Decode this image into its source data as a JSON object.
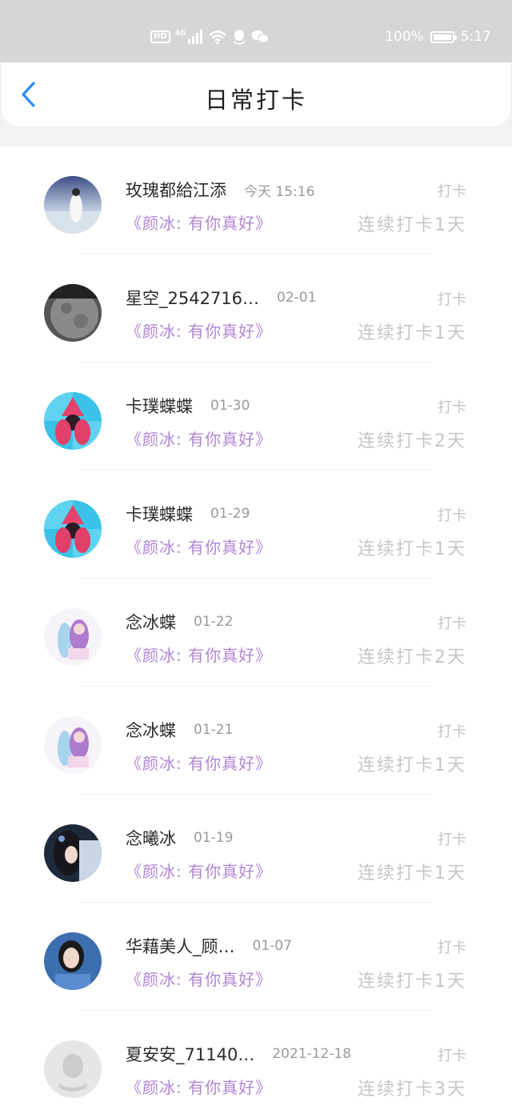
{
  "status_bar": {
    "hd": "HD",
    "network": "4G",
    "battery_percent": "100%",
    "time": "5:17",
    "icons": [
      "hd-icon",
      "signal-icon",
      "wifi-icon",
      "qq-icon",
      "wechat-icon",
      "battery-charging-icon"
    ]
  },
  "header": {
    "title": "日常打卡",
    "back_icon": "chevron-left-icon",
    "accent": "#2d8cf0"
  },
  "colors": {
    "book": "#b086d2",
    "muted": "#c6c6c6"
  },
  "entries": [
    {
      "name": "玫瑰都給江添",
      "time": "今天  15:16",
      "checkin": "打卡",
      "book": "《颜冰:  有你真好》",
      "streak": "连续打卡1天"
    },
    {
      "name": "星空_2542716…",
      "time": "02-01",
      "checkin": "打卡",
      "book": "《颜冰:  有你真好》",
      "streak": "连续打卡1天"
    },
    {
      "name": "卡璞蝶蝶",
      "time": "01-30",
      "checkin": "打卡",
      "book": "《颜冰:  有你真好》",
      "streak": "连续打卡2天"
    },
    {
      "name": "卡璞蝶蝶",
      "time": "01-29",
      "checkin": "打卡",
      "book": "《颜冰:  有你真好》",
      "streak": "连续打卡1天"
    },
    {
      "name": "念冰蝶",
      "time": "01-22",
      "checkin": "打卡",
      "book": "《颜冰:  有你真好》",
      "streak": "连续打卡2天"
    },
    {
      "name": "念冰蝶",
      "time": "01-21",
      "checkin": "打卡",
      "book": "《颜冰:  有你真好》",
      "streak": "连续打卡1天"
    },
    {
      "name": "念曦冰",
      "time": "01-19",
      "checkin": "打卡",
      "book": "《颜冰:  有你真好》",
      "streak": "连续打卡1天"
    },
    {
      "name": "华藉美人_顾…",
      "time": "01-07",
      "checkin": "打卡",
      "book": "《颜冰:  有你真好》",
      "streak": "连续打卡1天"
    },
    {
      "name": "夏安安_71140…",
      "time": "2021-12-18",
      "checkin": "打卡",
      "book": "《颜冰:  有你真好》",
      "streak": "连续打卡3天"
    }
  ]
}
